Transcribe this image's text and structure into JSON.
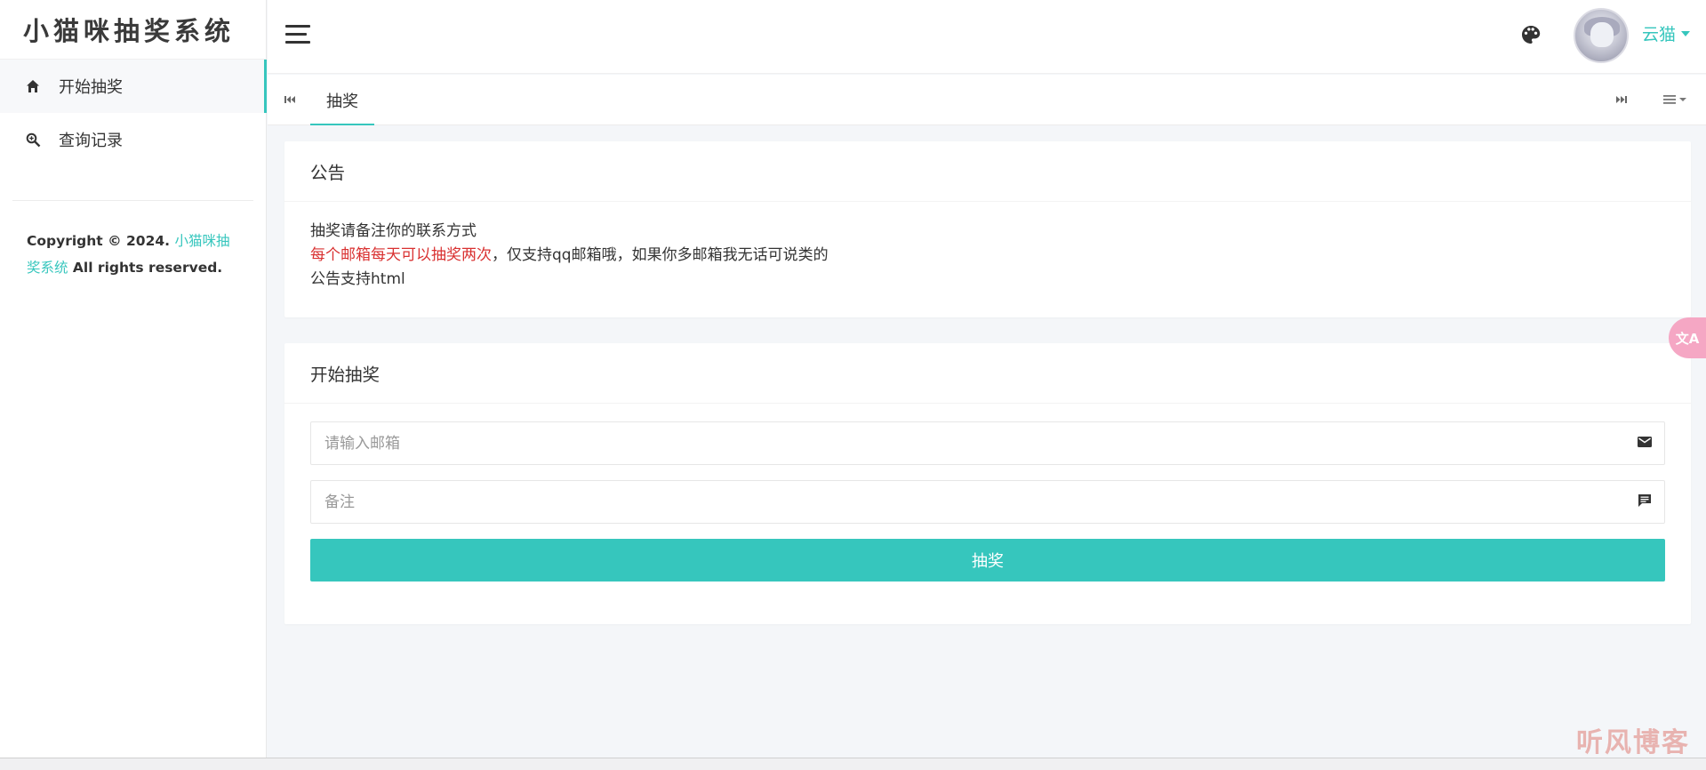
{
  "app": {
    "logo_text": "小猫咪抽奖系统"
  },
  "sidebar": {
    "items": [
      {
        "label": "开始抽奖",
        "icon": "home-icon",
        "active": true
      },
      {
        "label": "查询记录",
        "icon": "search-magnify-icon",
        "active": false
      }
    ],
    "copyright_prefix": "Copyright © 2024. ",
    "copyright_brand": "小猫咪抽奖系统",
    "copyright_suffix": " All rights reserved."
  },
  "header": {
    "username": "云猫",
    "icons": {
      "menu": "hamburger-icon",
      "theme": "palette-icon"
    }
  },
  "tabs": {
    "items": [
      {
        "label": "抽奖",
        "active": true
      }
    ]
  },
  "notice": {
    "title": "公告",
    "line1": "抽奖请备注你的联系方式",
    "line2_red": "每个邮箱每天可以抽奖两次",
    "line2_rest": "，仅支持qq邮箱哦，如果你多邮箱我无话可说类的",
    "line3": "公告支持html"
  },
  "draw": {
    "title": "开始抽奖",
    "email_placeholder": "请输入邮箱",
    "email_value": "",
    "remark_placeholder": "备注",
    "remark_value": "",
    "button_label": "抽奖"
  },
  "floating": {
    "translate_label": "文A"
  },
  "watermark": "听风博客",
  "colors": {
    "accent": "#36c6bd",
    "notice_red": "#d93131",
    "page_bg": "#f4f6f9"
  }
}
